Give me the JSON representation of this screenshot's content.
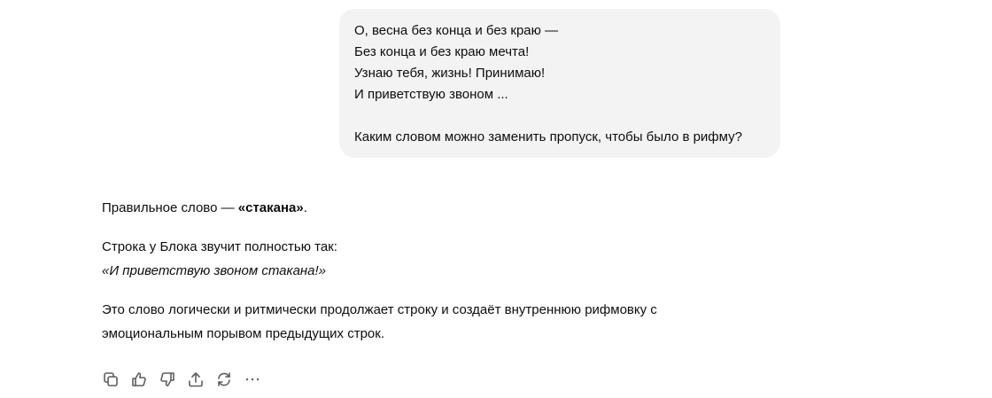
{
  "user_message": {
    "lines": [
      "О, весна без конца и без краю —",
      "Без конца и без краю мечта!",
      "Узнаю тебя, жизнь! Принимаю!",
      "И приветствую звоном ...",
      "",
      "Каким словом можно заменить пропуск, чтобы было в рифму?"
    ]
  },
  "assistant_message": {
    "answer_prefix": "Правильное слово — ",
    "answer_word": "«стакана»",
    "answer_suffix": ".",
    "intro": "Строка у Блока звучит полностью так:",
    "quote": "«И приветствую звоном стакана!»",
    "explanation_line1": "Это слово логически и ритмически продолжает строку и создаёт внутреннюю рифмовку с",
    "explanation_line2": "эмоциональным порывом предыдущих строк."
  },
  "actions": {
    "icons": [
      "copy-icon",
      "thumbs-up-icon",
      "thumbs-down-icon",
      "share-icon",
      "regenerate-icon",
      "more-icon"
    ]
  }
}
